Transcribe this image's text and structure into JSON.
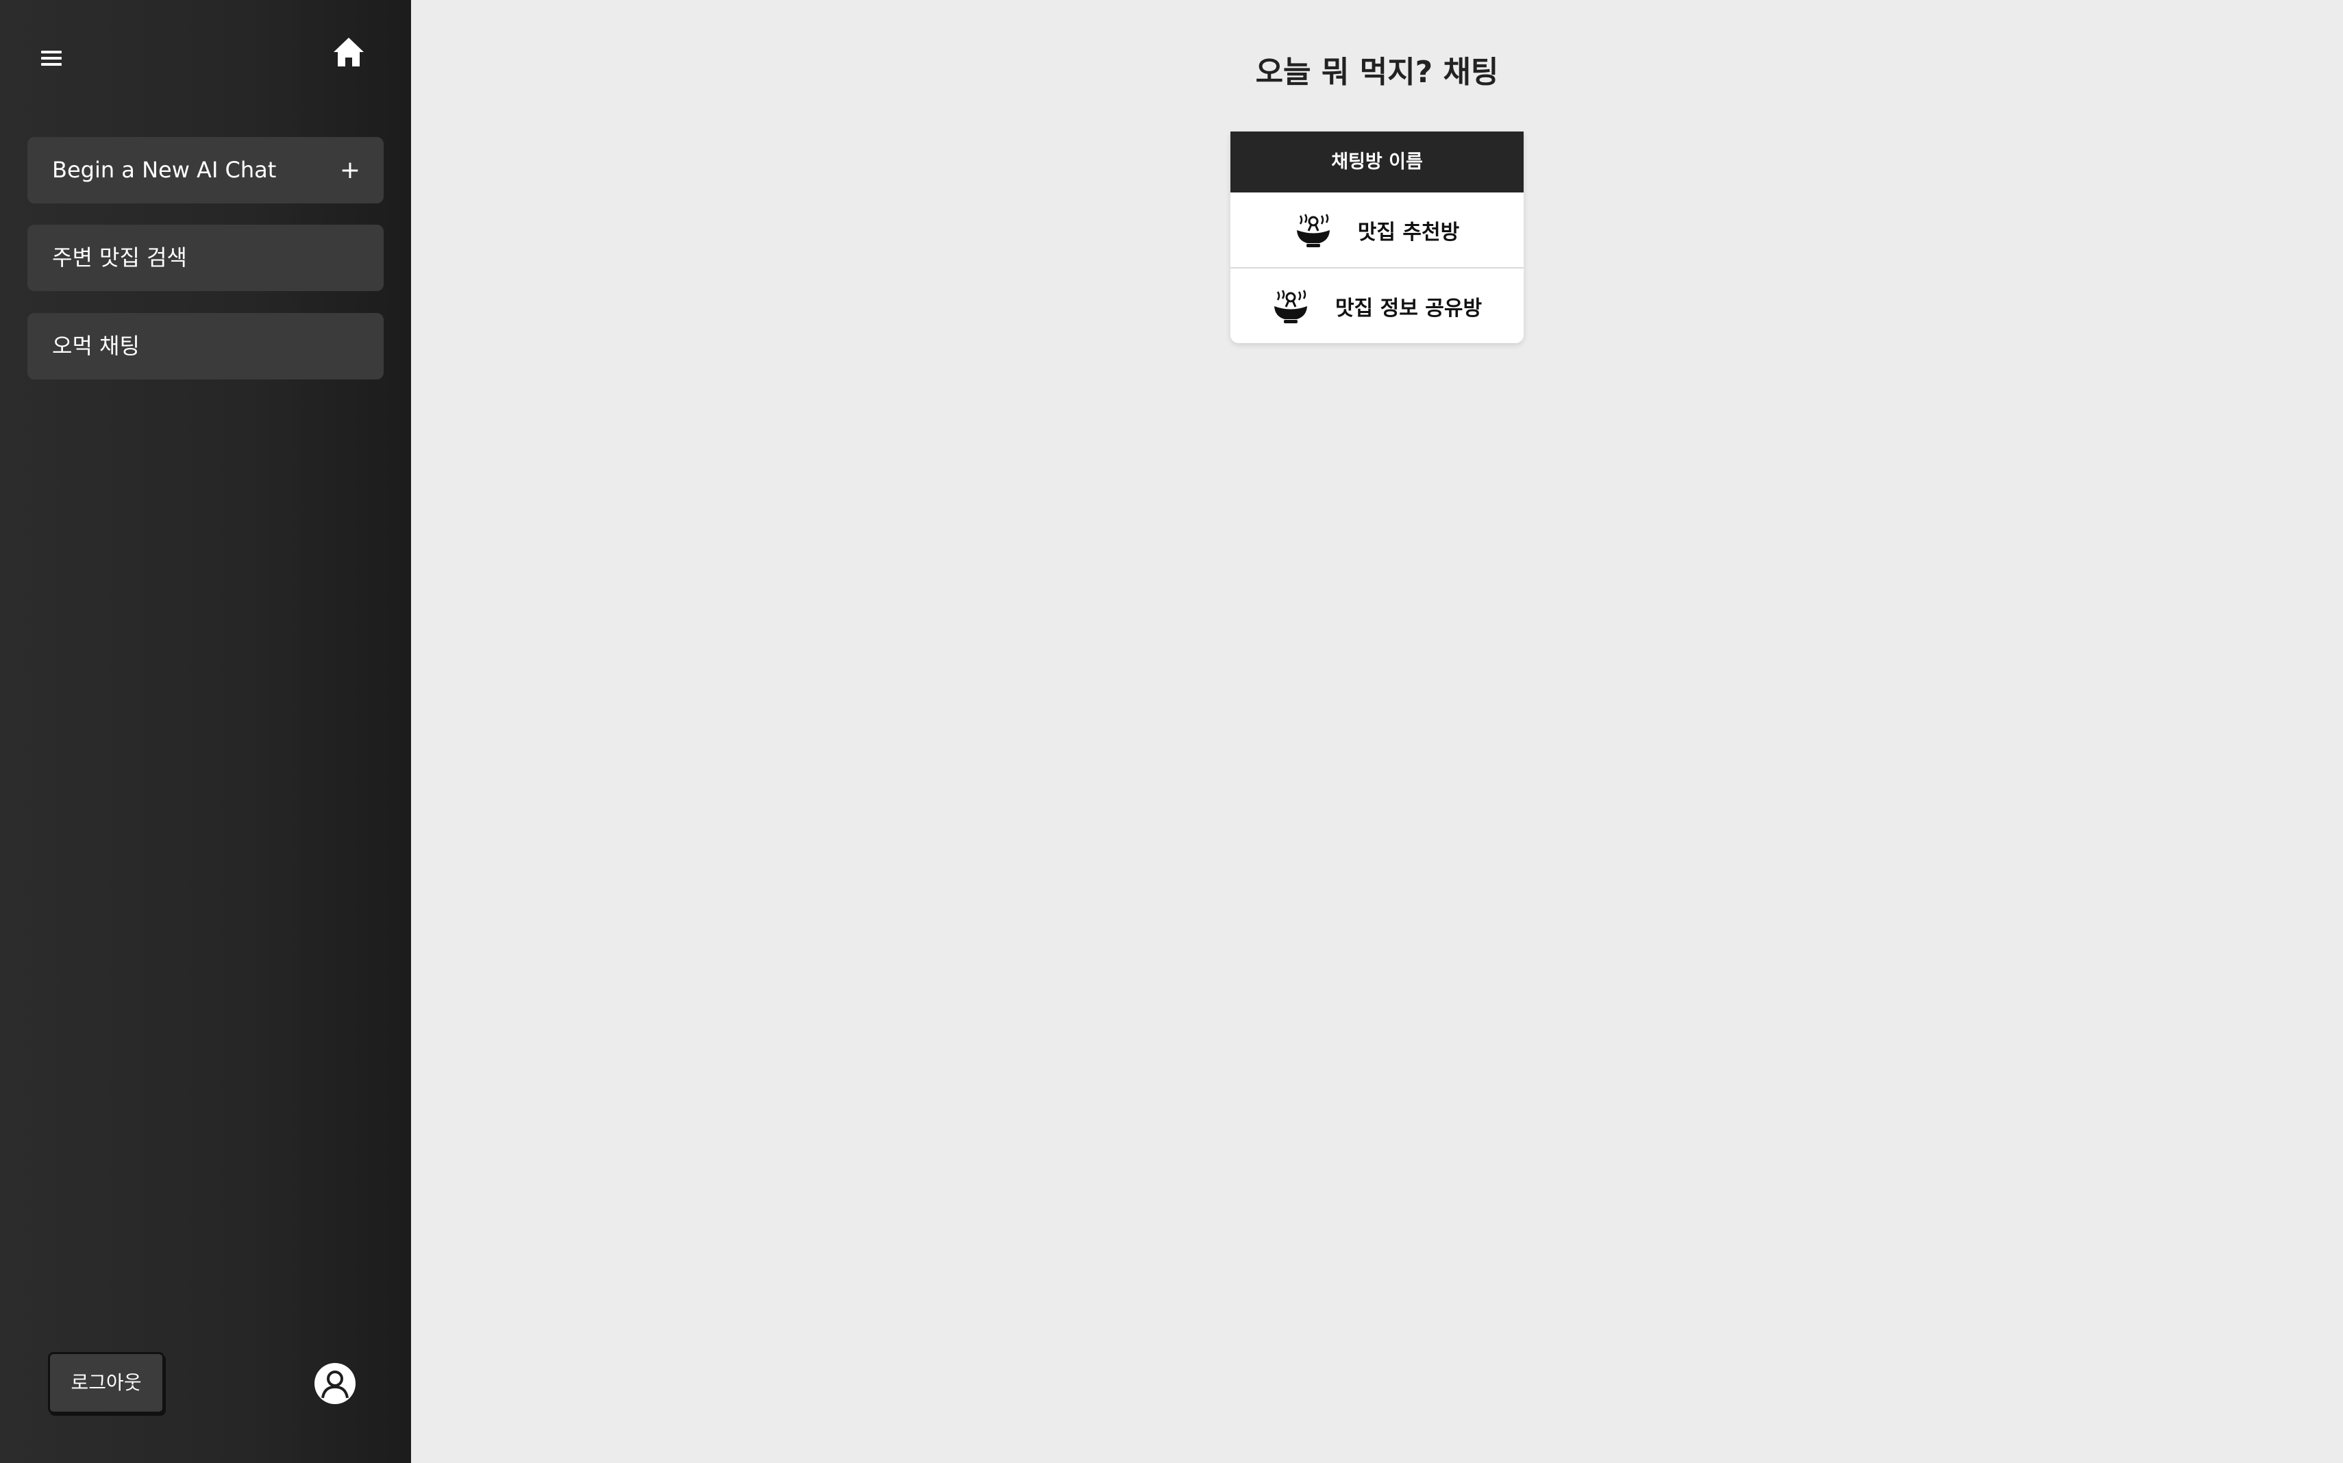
{
  "sidebar": {
    "icons": {
      "menu": "hamburger-menu-icon",
      "home": "home-icon",
      "new_chat": "plus-icon",
      "profile": "user-avatar-icon"
    },
    "new_chat_label": "Begin a New AI Chat",
    "new_chat_plus": "+",
    "items": [
      {
        "label": "주변 맛집 검색"
      },
      {
        "label": "오먹 채팅"
      }
    ],
    "logout_label": "로그아웃"
  },
  "main": {
    "title": "오늘 뭐 먹지? 채팅",
    "table": {
      "header": "채팅방 이름",
      "rooms": [
        {
          "name": "맛집 추천방",
          "icon": "food-bowl-icon"
        },
        {
          "name": "맛집 정보 공유방",
          "icon": "food-bowl-icon"
        }
      ]
    }
  },
  "colors": {
    "sidebar_bg": "#262626",
    "nav_item_bg": "#3b3b3b",
    "main_bg": "#ececec",
    "table_header_bg": "#262626",
    "text_dark": "#222222"
  }
}
